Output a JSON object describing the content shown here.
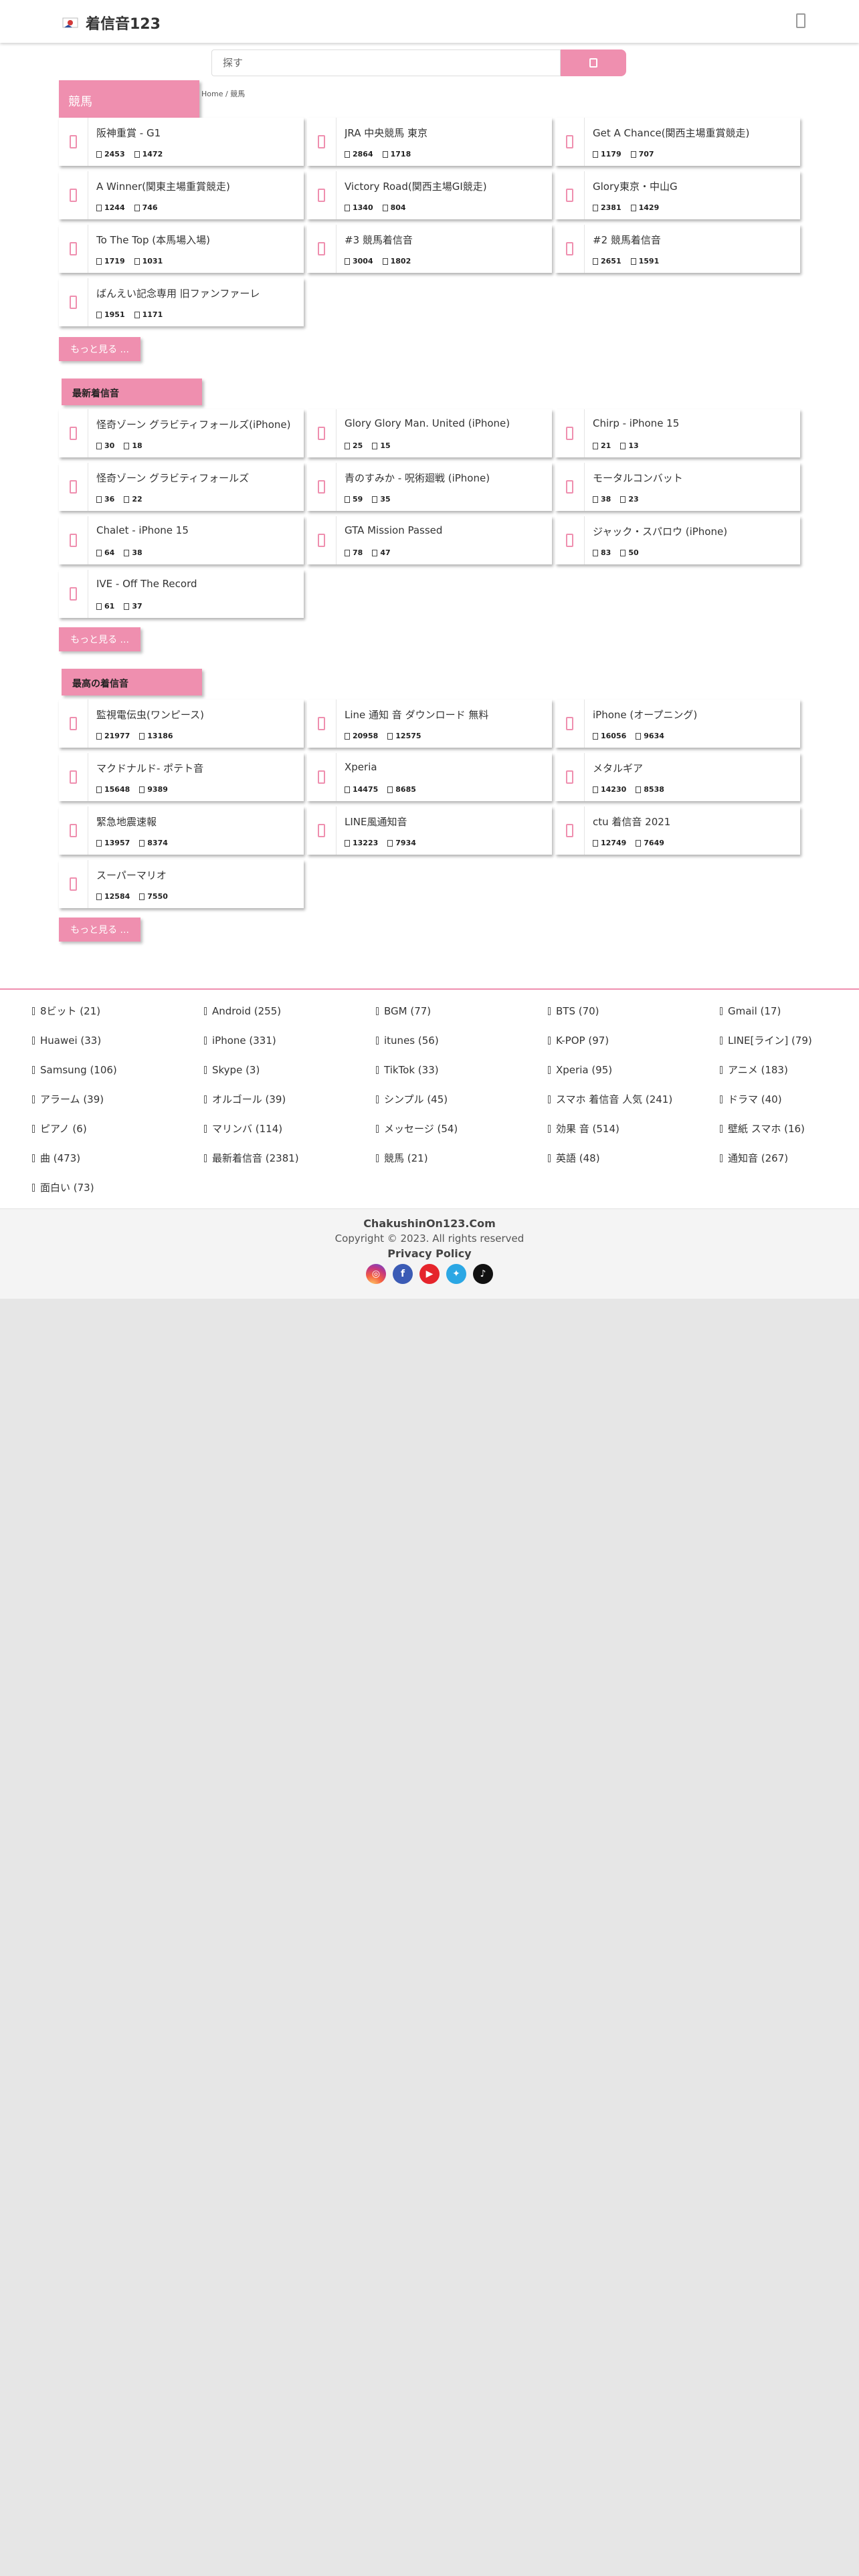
{
  "header": {
    "site_title": "着信音123"
  },
  "search": {
    "placeholder": "探す"
  },
  "breadcrumb": {
    "home": "Home",
    "separator": "/",
    "current": "競馬"
  },
  "sections": [
    {
      "title": "競馬",
      "items": [
        {
          "title": "阪神重賞 - G1",
          "downloads": "2453",
          "likes": "1472"
        },
        {
          "title": "JRA 中央競馬 東京",
          "downloads": "2864",
          "likes": "1718"
        },
        {
          "title": "Get A Chance(関西主場重賞競走)",
          "downloads": "1179",
          "likes": "707"
        },
        {
          "title": "A Winner(関東主場重賞競走)",
          "downloads": "1244",
          "likes": "746"
        },
        {
          "title": "Victory Road(関西主場GI競走)",
          "downloads": "1340",
          "likes": "804"
        },
        {
          "title": "Glory東京・中山G",
          "downloads": "2381",
          "likes": "1429"
        },
        {
          "title": "To The Top (本馬場入場)",
          "downloads": "1719",
          "likes": "1031"
        },
        {
          "title": "#3 競馬着信音",
          "downloads": "3004",
          "likes": "1802"
        },
        {
          "title": "#2 競馬着信音",
          "downloads": "2651",
          "likes": "1591"
        },
        {
          "title": "ばんえい記念専用 旧ファンファーレ",
          "downloads": "1951",
          "likes": "1171"
        }
      ],
      "more_label": "もっと見る ..."
    },
    {
      "title": "最新着信音",
      "items": [
        {
          "title": "怪奇ゾーン グラビティフォールズ(iPhone)",
          "downloads": "30",
          "likes": "18"
        },
        {
          "title": "Glory Glory Man. United (iPhone)",
          "downloads": "25",
          "likes": "15"
        },
        {
          "title": "Chirp - iPhone 15",
          "downloads": "21",
          "likes": "13"
        },
        {
          "title": "怪奇ゾーン グラビティフォールズ",
          "downloads": "36",
          "likes": "22"
        },
        {
          "title": "青のすみか - 呪術廻戦 (iPhone)",
          "downloads": "59",
          "likes": "35"
        },
        {
          "title": "モータルコンバット",
          "downloads": "38",
          "likes": "23"
        },
        {
          "title": "Chalet - iPhone 15",
          "downloads": "64",
          "likes": "38"
        },
        {
          "title": "GTA Mission Passed",
          "downloads": "78",
          "likes": "47"
        },
        {
          "title": "ジャック・スパロウ (iPhone)",
          "downloads": "83",
          "likes": "50"
        },
        {
          "title": "IVE - Off The Record",
          "downloads": "61",
          "likes": "37"
        }
      ],
      "more_label": "もっと見る ..."
    },
    {
      "title": "最高の着信音",
      "items": [
        {
          "title": "監視電伝虫(ワンピース)",
          "downloads": "21977",
          "likes": "13186"
        },
        {
          "title": "Line 通知 音 ダウンロード 無料",
          "downloads": "20958",
          "likes": "12575"
        },
        {
          "title": "iPhone (オープニング)",
          "downloads": "16056",
          "likes": "9634"
        },
        {
          "title": "マクドナルド- ポテト音",
          "downloads": "15648",
          "likes": "9389"
        },
        {
          "title": "Xperia",
          "downloads": "14475",
          "likes": "8685"
        },
        {
          "title": "メタルギア",
          "downloads": "14230",
          "likes": "8538"
        },
        {
          "title": "緊急地震速報",
          "downloads": "13957",
          "likes": "8374"
        },
        {
          "title": "LINE風通知音",
          "downloads": "13223",
          "likes": "7934"
        },
        {
          "title": "ctu 着信音 2021",
          "downloads": "12749",
          "likes": "7649"
        },
        {
          "title": "スーパーマリオ",
          "downloads": "12584",
          "likes": "7550"
        }
      ],
      "more_label": "もっと見る ..."
    }
  ],
  "categories": [
    "8ビット (21)",
    "Android (255)",
    "BGM (77)",
    "BTS (70)",
    "Gmail (17)",
    "Huawei (33)",
    "iPhone (331)",
    "itunes (56)",
    "K-POP (97)",
    "LINE[ライン] (79)",
    "Samsung (106)",
    "Skype (3)",
    "TikTok (33)",
    "Xperia (95)",
    "アニメ (183)",
    "アラーム (39)",
    "オルゴール (39)",
    "シンプル (45)",
    "スマホ 着信音 人気 (241)",
    "ドラマ (40)",
    "ピアノ (6)",
    "マリンバ (114)",
    "メッセージ (54)",
    "効果 音 (514)",
    "壁紙 スマホ (16)",
    "曲 (473)",
    "最新着信音 (2381)",
    "競馬 (21)",
    "英語 (48)",
    "通知音 (267)",
    "面白い (73)"
  ],
  "footer": {
    "site_name": "ChakushinOn123.Com",
    "copyright": "Copyright © 2023. All rights reserved",
    "privacy": "Privacy Policy",
    "social_icons": [
      "instagram-icon",
      "facebook-icon",
      "youtube-icon",
      "twitter-icon",
      "tiktok-icon"
    ]
  },
  "colors": {
    "accent": "#ef8faf",
    "page_bg": "#e6e6e6"
  }
}
